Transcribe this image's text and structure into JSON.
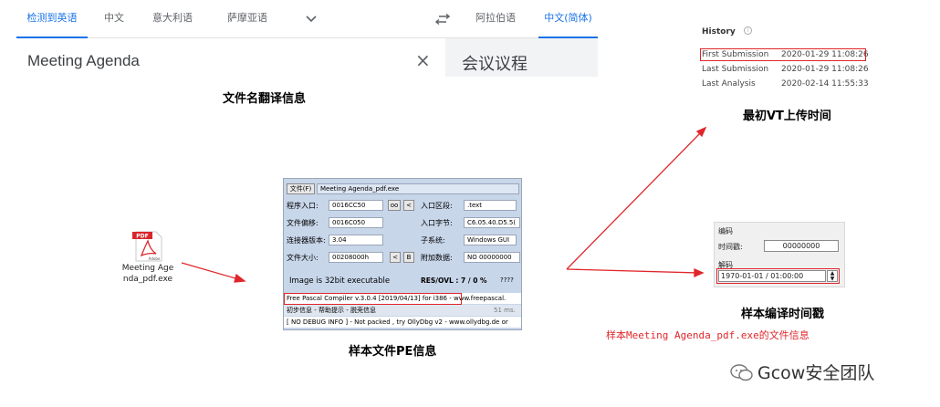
{
  "translator": {
    "tabs": [
      "检测到英语",
      "中文",
      "意大利语",
      "萨摩亚语"
    ],
    "target_tabs": [
      "阿拉伯语",
      "中文(简体)"
    ],
    "source_text": "Meeting Agenda",
    "translated_text": "会议议程",
    "accent_color": "#1a73e8"
  },
  "captions": {
    "filename_translation": "文件名翻译信息",
    "vt_upload": "最初VT上传时间",
    "pe_info": "样本文件PE信息",
    "compile_time": "样本编译时间戳"
  },
  "history": {
    "title": "History",
    "rows": [
      {
        "label": "First Submission",
        "value": "2020-01-29 11:08:26"
      },
      {
        "label": "Last Submission",
        "value": "2020-01-29 11:08:26"
      },
      {
        "label": "Last Analysis",
        "value": "2020-02-14 11:55:33"
      }
    ]
  },
  "pdf_icon": {
    "badge": "PDF",
    "brand": "Adobe",
    "filename": "Meeting Agenda_pdf.exe"
  },
  "pe_window": {
    "file_button": "文件(F)",
    "file_path": "Meeting Agenda_pdf.exe",
    "entry_point_label": "程序入口:",
    "entry_point_value": "0016CC50",
    "oo_button": "oo",
    "lt_button": "<",
    "entry_section_label": "入口区段:",
    "entry_section_value": ".text",
    "file_offset_label": "文件偏移:",
    "file_offset_value": "0016C050",
    "entry_bytes_label": "入口字节:",
    "entry_bytes_value": "C6.05.40.D5.5(",
    "linker_label": "连接器版本:",
    "linker_value": "3.04",
    "subsystem_label": "子系统:",
    "subsystem_value": "Windows GUI",
    "file_size_label": "文件大小:",
    "file_size_value": "00208000h",
    "b_button": "B",
    "overlay_label": "附加数据:",
    "overlay_value": "NO  00000000",
    "image_bits": "Image is 32bit executable",
    "res_ovl": "RES/OVL : 7 / 0 %",
    "qmarks": "????",
    "compiler_line": "Free Pascal Compiler v.3.0.4 [2019/04/13] for i386",
    "compiler_suffix": "- www.freepascal.",
    "hint_line": "初步信息 - 帮助提示 - 脱壳信息",
    "hint_suffix": "51 ms.",
    "debug_line": "[ NO DEBUG INFO ] - Not packed , try OllyDbg v2 - www.ollydbg.de or"
  },
  "compile_panel": {
    "encode_label": "编码",
    "timestamp_label": "时间戳:",
    "timestamp_value": "00000000",
    "decode_label": "解码",
    "decoded_value": "1970-01-01 / 01:00:00"
  },
  "note": "样本Meeting Agenda_pdf.exe的文件信息",
  "watermark": "Gcow安全团队",
  "annotation_color": "#e0262b"
}
